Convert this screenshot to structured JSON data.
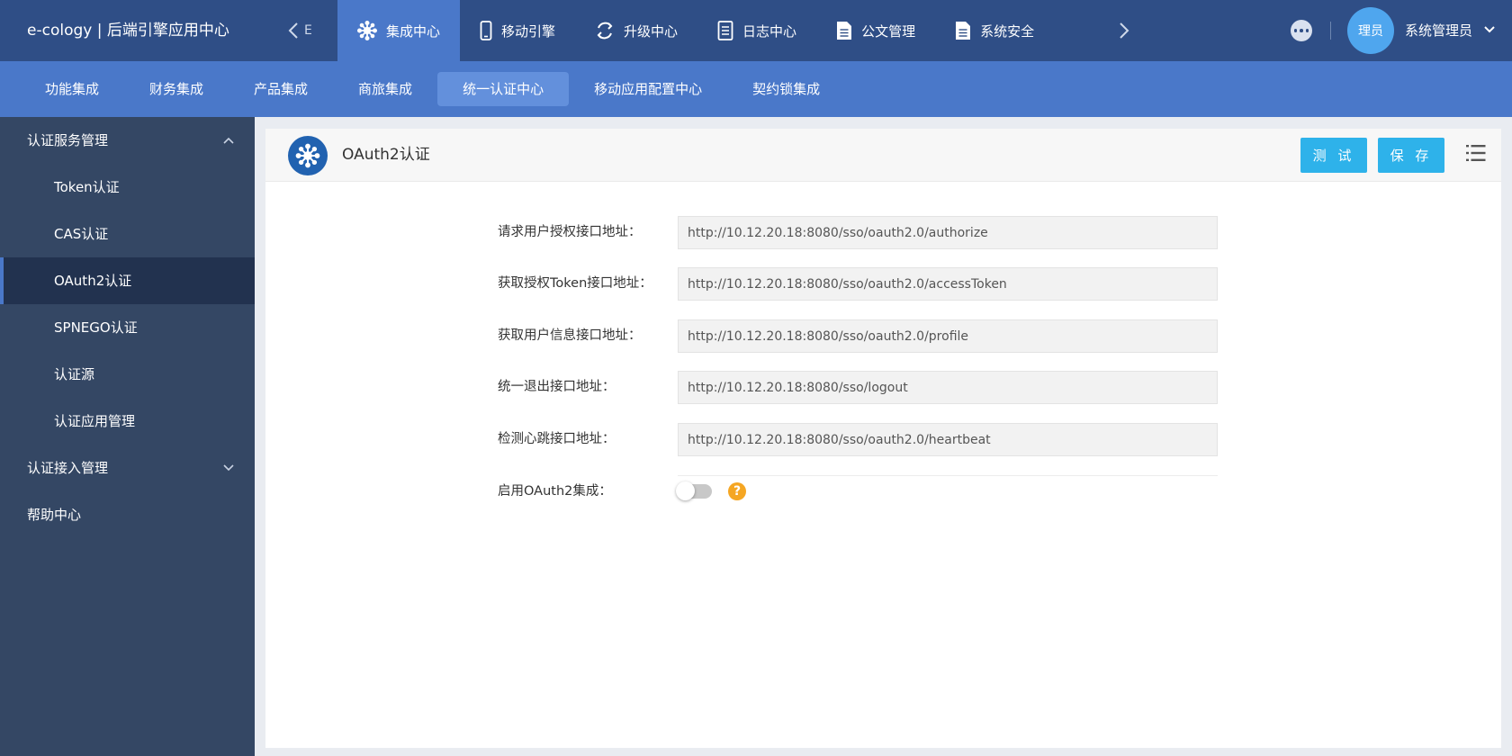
{
  "app": {
    "brand": "e-cology | 后端引擎应用中心",
    "overflow_glyph": "E"
  },
  "top_tabs": [
    {
      "label": "集成中心",
      "icon": "integration-icon",
      "active": true
    },
    {
      "label": "移动引擎",
      "icon": "mobile-icon",
      "active": false
    },
    {
      "label": "升级中心",
      "icon": "upgrade-icon",
      "active": false
    },
    {
      "label": "日志中心",
      "icon": "log-icon",
      "active": false
    },
    {
      "label": "公文管理",
      "icon": "document-icon",
      "active": false
    },
    {
      "label": "系统安全",
      "icon": "document-icon",
      "active": false
    }
  ],
  "user": {
    "avatar_text": "理员",
    "name": "系统管理员"
  },
  "sub_nav": [
    {
      "label": "功能集成",
      "active": false
    },
    {
      "label": "财务集成",
      "active": false
    },
    {
      "label": "产品集成",
      "active": false
    },
    {
      "label": "商旅集成",
      "active": false
    },
    {
      "label": "统一认证中心",
      "active": true
    },
    {
      "label": "移动应用配置中心",
      "active": false
    },
    {
      "label": "契约锁集成",
      "active": false
    }
  ],
  "sidebar": {
    "groups": [
      {
        "label": "认证服务管理",
        "expanded": true,
        "items": [
          {
            "label": "Token认证",
            "active": false
          },
          {
            "label": "CAS认证",
            "active": false
          },
          {
            "label": "OAuth2认证",
            "active": true
          },
          {
            "label": "SPNEGO认证",
            "active": false
          },
          {
            "label": "认证源",
            "active": false
          },
          {
            "label": "认证应用管理",
            "active": false
          }
        ]
      },
      {
        "label": "认证接入管理",
        "expanded": false,
        "items": []
      },
      {
        "label": "帮助中心",
        "items": []
      }
    ]
  },
  "panel": {
    "title": "OAuth2认证",
    "test_label": "测 试",
    "save_label": "保 存"
  },
  "form": {
    "fields": [
      {
        "label": "请求用户授权接口地址：",
        "value": "http://10.12.20.18:8080/sso/oauth2.0/authorize"
      },
      {
        "label": "获取授权Token接口地址：",
        "value": "http://10.12.20.18:8080/sso/oauth2.0/accessToken"
      },
      {
        "label": "获取用户信息接口地址：",
        "value": "http://10.12.20.18:8080/sso/oauth2.0/profile"
      },
      {
        "label": "统一退出接口地址：",
        "value": "http://10.12.20.18:8080/sso/logout"
      },
      {
        "label": "检测心跳接口地址：",
        "value": "http://10.12.20.18:8080/sso/oauth2.0/heartbeat"
      }
    ],
    "toggle": {
      "label": "启用OAuth2集成：",
      "enabled": false
    },
    "help_glyph": "?"
  },
  "colors": {
    "topbar": "#2f4e86",
    "subnav": "#4a78c9",
    "sidebar": "#344764",
    "sidebar_active": "#22324f",
    "button": "#2eb2ea",
    "help": "#f5a623"
  }
}
